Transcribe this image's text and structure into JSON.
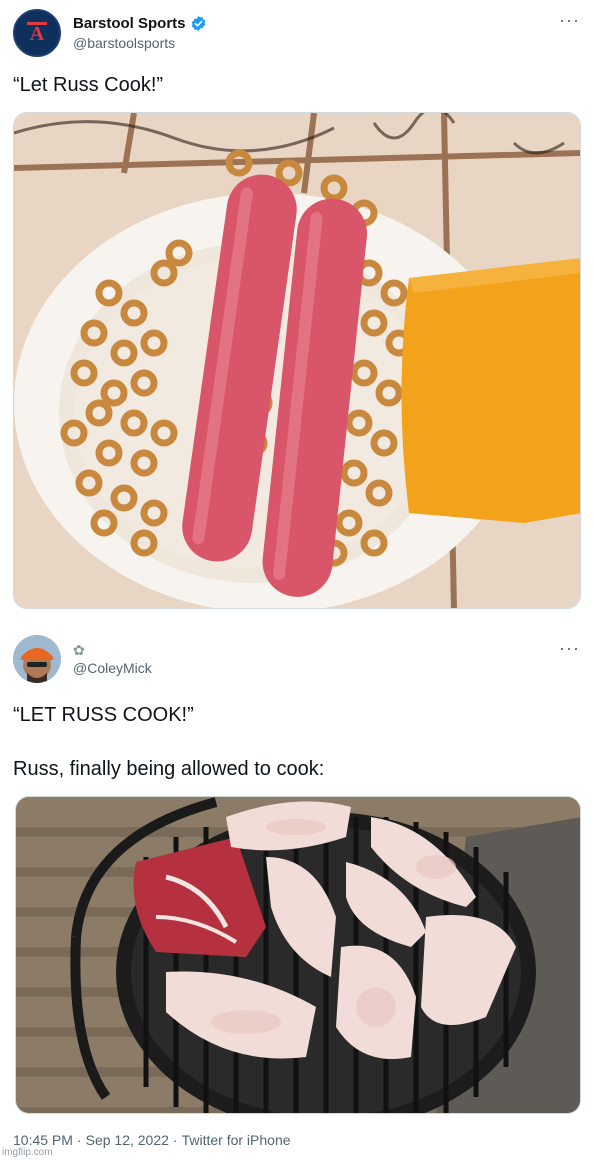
{
  "tweet1": {
    "display_name": "Barstool Sports",
    "handle": "@barstoolsports",
    "text": "“Let Russ Cook!”",
    "more_icon": "more-horizontal-icon",
    "verified_icon": "verified-badge-icon",
    "media_description_icon": "photo"
  },
  "tweet2": {
    "display_name_icon": "flower-emoji",
    "handle": "@ColeyMick",
    "text_line1": "“LET RUSS COOK!”",
    "text_line2": "Russ, finally being allowed to cook:",
    "more_icon": "more-horizontal-icon",
    "time": "10:45 PM",
    "separator": "·",
    "date": "Sep 12, 2022",
    "source": "Twitter for iPhone"
  },
  "watermark": "imgflip.com",
  "colors": {
    "text_primary": "#0f1419",
    "text_secondary": "#536471",
    "verified_blue": "#1d9bf0",
    "border": "#cfd9de"
  }
}
